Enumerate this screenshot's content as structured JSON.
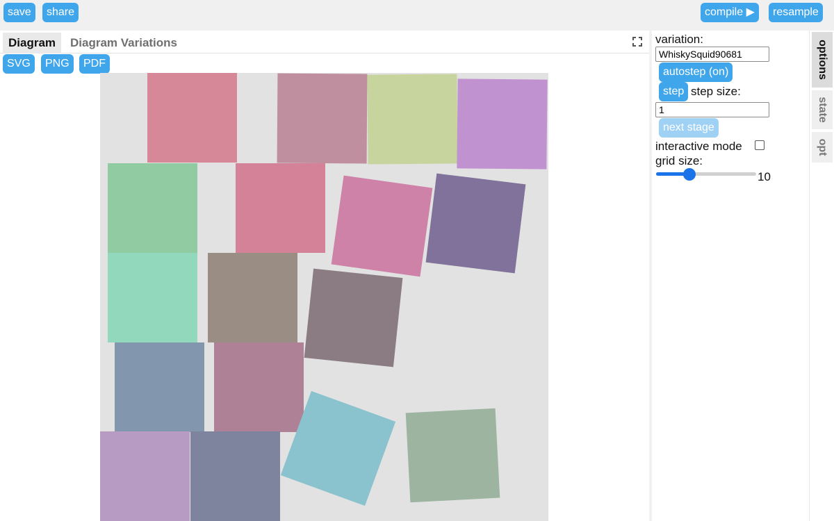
{
  "toolbar": {
    "save_label": "save",
    "share_label": "share",
    "compile_label": "compile ▶",
    "resample_label": "resample"
  },
  "tabs": {
    "diagram_label": "Diagram",
    "variations_label": "Diagram Variations"
  },
  "export": {
    "svg_label": "SVG",
    "png_label": "PNG",
    "pdf_label": "PDF"
  },
  "options": {
    "variation_label": "variation:",
    "variation_value": "WhiskySquid90681",
    "autostep_label": "autostep (on)",
    "step_label": "step",
    "step_size_label": "step size:",
    "step_size_value": "1",
    "next_stage_label": "next stage",
    "interactive_mode_label": "interactive mode",
    "interactive_mode_checked": false,
    "grid_size_label": "grid size:",
    "grid_size_value": "10",
    "grid_size_fraction": 0.33
  },
  "side_tabs": [
    "options",
    "state",
    "opt"
  ],
  "colors": {
    "accent": "#40a6ec",
    "accent_disabled": "#9fd1f5",
    "canvas_bg": "#e2e2e2",
    "slider": "#1a73e8"
  },
  "diagram": {
    "squares": [
      {
        "color": "#d78898"
      },
      {
        "color": "#bf8fa0"
      },
      {
        "color": "#c8d49e"
      },
      {
        "color": "#c192d0"
      },
      {
        "color": "#90cba2"
      },
      {
        "color": "#d38298"
      },
      {
        "color": "#ce82a8"
      },
      {
        "color": "#80729a"
      },
      {
        "color": "#92d8bd"
      },
      {
        "color": "#9a8d84"
      },
      {
        "color": "#8a7c82"
      },
      {
        "color": "#8296ae"
      },
      {
        "color": "#af8196"
      },
      {
        "color": "#b79bc2"
      },
      {
        "color": "#7e839e"
      },
      {
        "color": "#8ac3ce"
      },
      {
        "color": "#9cb4a0"
      }
    ]
  }
}
